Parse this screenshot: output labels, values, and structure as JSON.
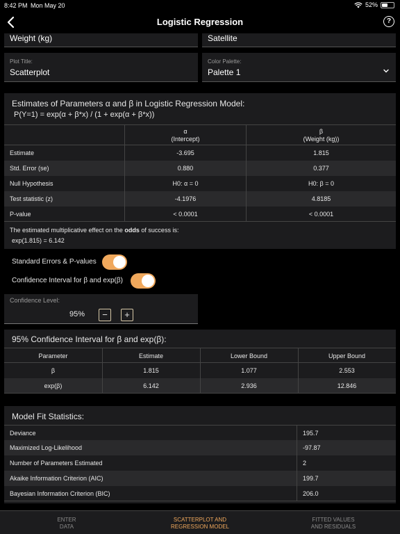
{
  "status_bar": {
    "time": "8:42 PM",
    "date": "Mon May 20",
    "battery": "52%",
    "battery_level": 0.52
  },
  "header": {
    "title": "Logistic Regression"
  },
  "fields": {
    "top_left_value": "Weight (kg)",
    "top_right_value": "Satellite",
    "plot_title_label": "Plot Title:",
    "plot_title_value": "Scatterplot",
    "palette_label": "Color Palette:",
    "palette_value": "Palette 1"
  },
  "estimates": {
    "title": "Estimates of Parameters α and β in Logistic Regression Model:",
    "formula": "P(Y=1) = exp(α + β*x) / (1 + exp(α + β*x))",
    "columns": [
      {
        "symbol": "α",
        "sub": "(Intercept)"
      },
      {
        "symbol": "β",
        "sub": "(Weight (kg))"
      }
    ],
    "rows": [
      {
        "label": "Estimate",
        "alpha": "-3.695",
        "beta": "1.815"
      },
      {
        "label": "Std. Error (se)",
        "alpha": "0.880",
        "beta": "0.377"
      },
      {
        "label": "Null Hypothesis",
        "alpha": "H0: α = 0",
        "beta": "H0: β = 0"
      },
      {
        "label": "Test statistic (z)",
        "alpha": "-4.1976",
        "beta": "4.8185"
      },
      {
        "label": "P-value",
        "alpha": "< 0.0001",
        "beta": "< 0.0001"
      }
    ],
    "note_prefix": "The estimated multiplicative effect on the ",
    "note_bold": "odds",
    "note_suffix": " of success is:",
    "note_value": "exp(1.815) = 6.142"
  },
  "toggles": [
    {
      "label": "Standard Errors & P-values",
      "on": true
    },
    {
      "label": "Confidence Interval for β and exp(β)",
      "on": true
    }
  ],
  "confidence": {
    "label": "Confidence Level:",
    "value": "95%",
    "minus": "−",
    "plus": "+"
  },
  "ci": {
    "title": "95% Confidence Interval for β and exp(β):",
    "headers": [
      "Parameter",
      "Estimate",
      "Lower Bound",
      "Upper Bound"
    ],
    "rows": [
      [
        "β",
        "1.815",
        "1.077",
        "2.553"
      ],
      [
        "exp(β)",
        "6.142",
        "2.936",
        "12.846"
      ]
    ]
  },
  "model_fit": {
    "title": "Model Fit Statistics:",
    "rows": [
      {
        "label": "Deviance",
        "value": "195.7"
      },
      {
        "label": "Maximized Log-Likelihood",
        "value": "-97.87"
      },
      {
        "label": "Number of Parameters Estimated",
        "value": "2"
      },
      {
        "label": "Akaike Information Criterion (AIC)",
        "value": "199.7"
      },
      {
        "label": "Bayesian Information Criterion (BIC)",
        "value": "206.0"
      }
    ]
  },
  "tabs": [
    {
      "line1": "ENTER",
      "line2": "DATA",
      "active": false
    },
    {
      "line1": "SCATTERPLOT AND",
      "line2": "REGRESSION MODEL",
      "active": true
    },
    {
      "line1": "FITTED VALUES",
      "line2": "AND RESIDUALS",
      "active": false
    }
  ],
  "colors": {
    "accent": "#f0a85c",
    "background": "#000000",
    "panel": "#1c1c1e",
    "row_alt": "#2a2a2c"
  }
}
